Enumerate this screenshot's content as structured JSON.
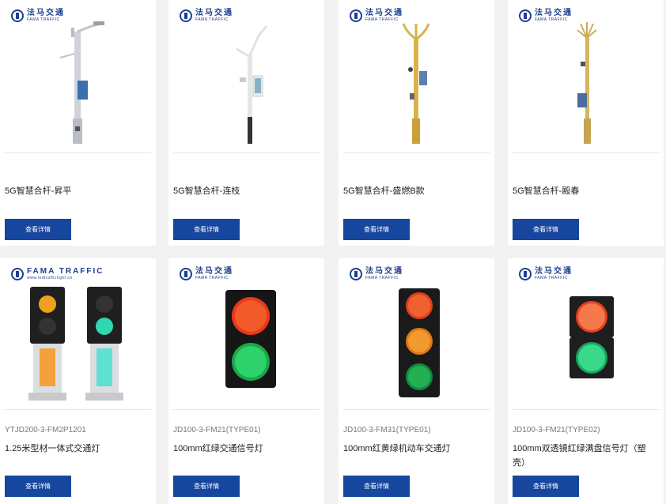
{
  "brand": {
    "cn": "法马交通",
    "en": "FAMA TRAFFIC",
    "alt_en": "FAMA TRAFFIC",
    "alt_url": "www.ledtrafficlight.cn"
  },
  "products": [
    {
      "model": "",
      "name": "5G智慧合杆-昇平",
      "button": "查看详情",
      "type": "pole-silver"
    },
    {
      "model": "",
      "name": "5G智慧合杆-连枝",
      "button": "查看详情",
      "type": "pole-white"
    },
    {
      "model": "",
      "name": "5G智慧合杆-盛燃B款",
      "button": "查看详情",
      "type": "pole-gold"
    },
    {
      "model": "",
      "name": "5G智慧合杆-殿春",
      "button": "查看详情",
      "type": "pole-gold2"
    },
    {
      "model": "YTJD200-3-FM2P1201",
      "name": "1.25米型材一体式交通灯",
      "button": "查看详情",
      "type": "integrated"
    },
    {
      "model": "JD100-3-FM21(TYPE01)",
      "name": "100mm红绿交通信号灯",
      "button": "查看详情",
      "type": "rg-square"
    },
    {
      "model": "JD100-3-FM31(TYPE01)",
      "name": "100mm红黄绿机动车交通灯",
      "button": "查看详情",
      "type": "ryg"
    },
    {
      "model": "JD100-3-FM21(TYPE02)",
      "name": "100mm双透镜红绿满盘信号灯（塑壳）",
      "button": "查看详情",
      "type": "rg-small"
    }
  ]
}
